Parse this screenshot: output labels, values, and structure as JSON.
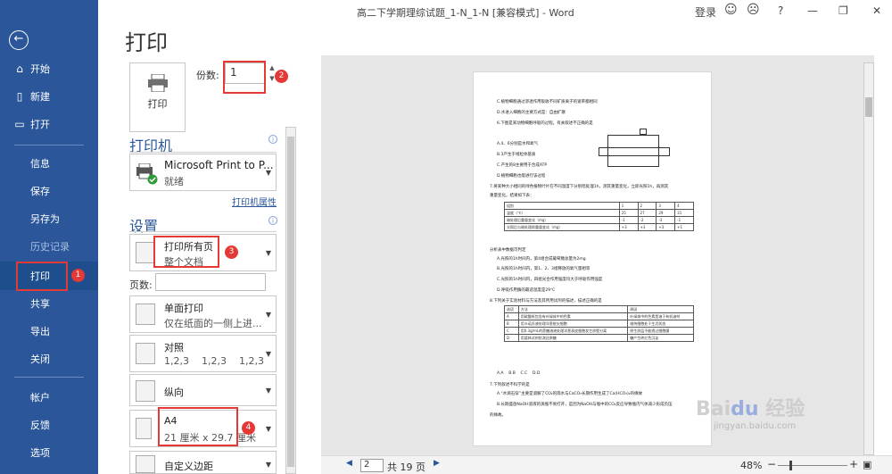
{
  "window": {
    "title": "高二下学期理综试题_1-N_1-N [兼容模式] - Word",
    "login": "登录",
    "help": "?"
  },
  "sidebar": {
    "items": [
      {
        "label": "开始",
        "icon": "home-icon"
      },
      {
        "label": "新建",
        "icon": "new-doc-icon"
      },
      {
        "label": "打开",
        "icon": "folder-icon"
      },
      {
        "label": "信息"
      },
      {
        "label": "保存"
      },
      {
        "label": "另存为"
      },
      {
        "label": "历史记录"
      },
      {
        "label": "打印"
      },
      {
        "label": "共享"
      },
      {
        "label": "导出"
      },
      {
        "label": "关闭"
      },
      {
        "label": "帐户"
      },
      {
        "label": "反馈"
      },
      {
        "label": "选项"
      }
    ]
  },
  "main": {
    "page_title": "打印",
    "print_button": "打印",
    "copies_label": "份数:",
    "copies_value": "1",
    "printer_section": "打印机",
    "printer_name": "Microsoft Print to P...",
    "printer_status": "就绪",
    "printer_props": "打印机属性",
    "settings_section": "设置",
    "settings": [
      {
        "t1": "打印所有页",
        "t2": "整个文档"
      },
      {
        "t1": "单面打印",
        "t2": "仅在纸面的一侧上进..."
      },
      {
        "t1": "对照",
        "t2": "1,2,3    1,2,3    1,2,3"
      },
      {
        "t1": "纵向",
        "t2": ""
      },
      {
        "t1": "A4",
        "t2": "21 厘米 x 29.7 厘米"
      },
      {
        "t1": "自定义边距",
        "t2": ""
      }
    ],
    "pages_label": "页数:"
  },
  "annotations": [
    "1",
    "2",
    "3",
    "4"
  ],
  "status": {
    "page": "2",
    "of": "共 19 页",
    "zoom": "48%",
    "prev": "◀",
    "next": "▶"
  },
  "watermark": {
    "brand": "Baidu 经验",
    "url": "jingyan.baidu.com"
  },
  "preview": {
    "lines": [
      "C.植物细胞通过渗透作用吸收不同矿质离子的速率都相同",
      "D.水进入细胞的主要方式是：自由扩散",
      "6.下图是某动物细胞呼吸的过程。有关叙述不正确的是",
      "A.4、6分别是水和氧气",
      "B.3产生于线粒体基质",
      "C.产生的8主要用于合成ATP",
      "D.植物细胞也能进行该过程",
      "7.将某种大小相同的绿色植物叶片在不同温度下分别暗处理1h，测其重量变化，立即光照1h，再测其",
      "重量变化。结果如下表：",
      "分析表中数据可判定",
      "A.光照的1h时间内，第4组合成葡萄糖总量为2mg",
      "B.光照的1h时间内，第1、2、3组释放的氧气量相等",
      "C.光照的1h时间内，四组光合作用强度均大于呼吸作用强度",
      "D.呼吸作用酶的最适温度是29℃",
      "8.下列关于实验材料与方法及其所用试剂的描述，描述正确的是",
      "A.A    B.B    C.C    D.D",
      "7.下列叙述不科学的是",
      "A.“水滴石穿”主要是溶解了CO₂的雨水与CaCO₃长期作用生成了Ca(HCO₃)₂的缘故",
      "B.长期盛放NaOH溶液的滴瓶不易打开，是因为NaOH与瓶中的CO₂反应导致瓶内气体减少形成负压",
      "的缘故。"
    ],
    "table1": [
      [
        "组别",
        "1",
        "2",
        "3",
        "4"
      ],
      [
        "温度（℃）",
        "25",
        "27",
        "29",
        "31"
      ],
      [
        "暗处理后重量变化（mg）",
        "-1",
        "-2",
        "-3",
        "-1"
      ],
      [
        "光照后与暗处理前重量变化（mg）",
        "+3",
        "+3",
        "+3",
        "+1"
      ]
    ],
    "table2": [
      [
        "选项",
        "方法",
        "原因"
      ],
      [
        "A",
        "用硫酸纸包含有叶绿体中的色素",
        "叶绿体中的色素是溶于有机溶剂"
      ],
      [
        "B",
        "用卡诺氏液处理洋葱根尖细胞",
        "维持细胞处于生活状态"
      ],
      [
        "C",
        "用0.3g/mL的蔗糖溶液处理洋葱表皮细胞发生质壁分离",
        "原生质层不能透过细胞膜"
      ],
      [
        "D",
        "用斐林试剂检测还原糖",
        "糖产生砖红色沉淀"
      ]
    ]
  }
}
